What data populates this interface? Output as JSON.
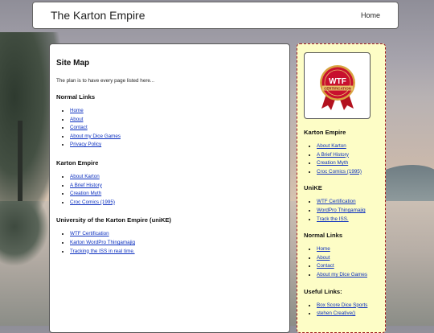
{
  "header": {
    "site_title": "The Karton Empire",
    "nav_home": "Home"
  },
  "main": {
    "title": "Site Map",
    "intro": "The plan is to have every page listed here...",
    "sections": [
      {
        "heading": "Normal Links",
        "links": [
          "Home",
          "About",
          "Contact",
          "About my Dice Games",
          "Privacy Policy"
        ]
      },
      {
        "heading": "Karton Empire",
        "links": [
          "About Karton",
          "A Brief History",
          "Creation Myth",
          "Croc Comics (1995)"
        ]
      },
      {
        "heading": "University of the Karton Empire (uniKE)",
        "links": [
          "WTF Certification",
          "Karton WordPro Thingamajig",
          "Tracking the ISS in real time."
        ]
      }
    ]
  },
  "sidebar": {
    "badge": {
      "text_top": "WTF",
      "text_banner": "CERTIFICATION",
      "colors": {
        "seal": "#c8102e",
        "rim": "#d9a441",
        "ribbon": "#b3121f"
      }
    },
    "widgets": [
      {
        "heading": "Karton Empire",
        "links": [
          "About Karton",
          "A Brief History",
          "Creation Myth",
          "Croc Comics (1995)"
        ]
      },
      {
        "heading": "UniKE",
        "links": [
          "WTF Certification",
          "WordPro Thingamajig",
          "Track the ISS."
        ]
      },
      {
        "heading": "Normal Links",
        "links": [
          "Home",
          "About",
          "Contact",
          "About my Dice Games"
        ]
      },
      {
        "heading": "Useful Links:",
        "links": [
          "Box Score Dice Sports",
          "stehen Creative()"
        ]
      }
    ]
  },
  "colors": {
    "link": "#0b2fbf",
    "sidebar_bg": "#fdfdc6",
    "sidebar_border": "#a01c1c"
  }
}
